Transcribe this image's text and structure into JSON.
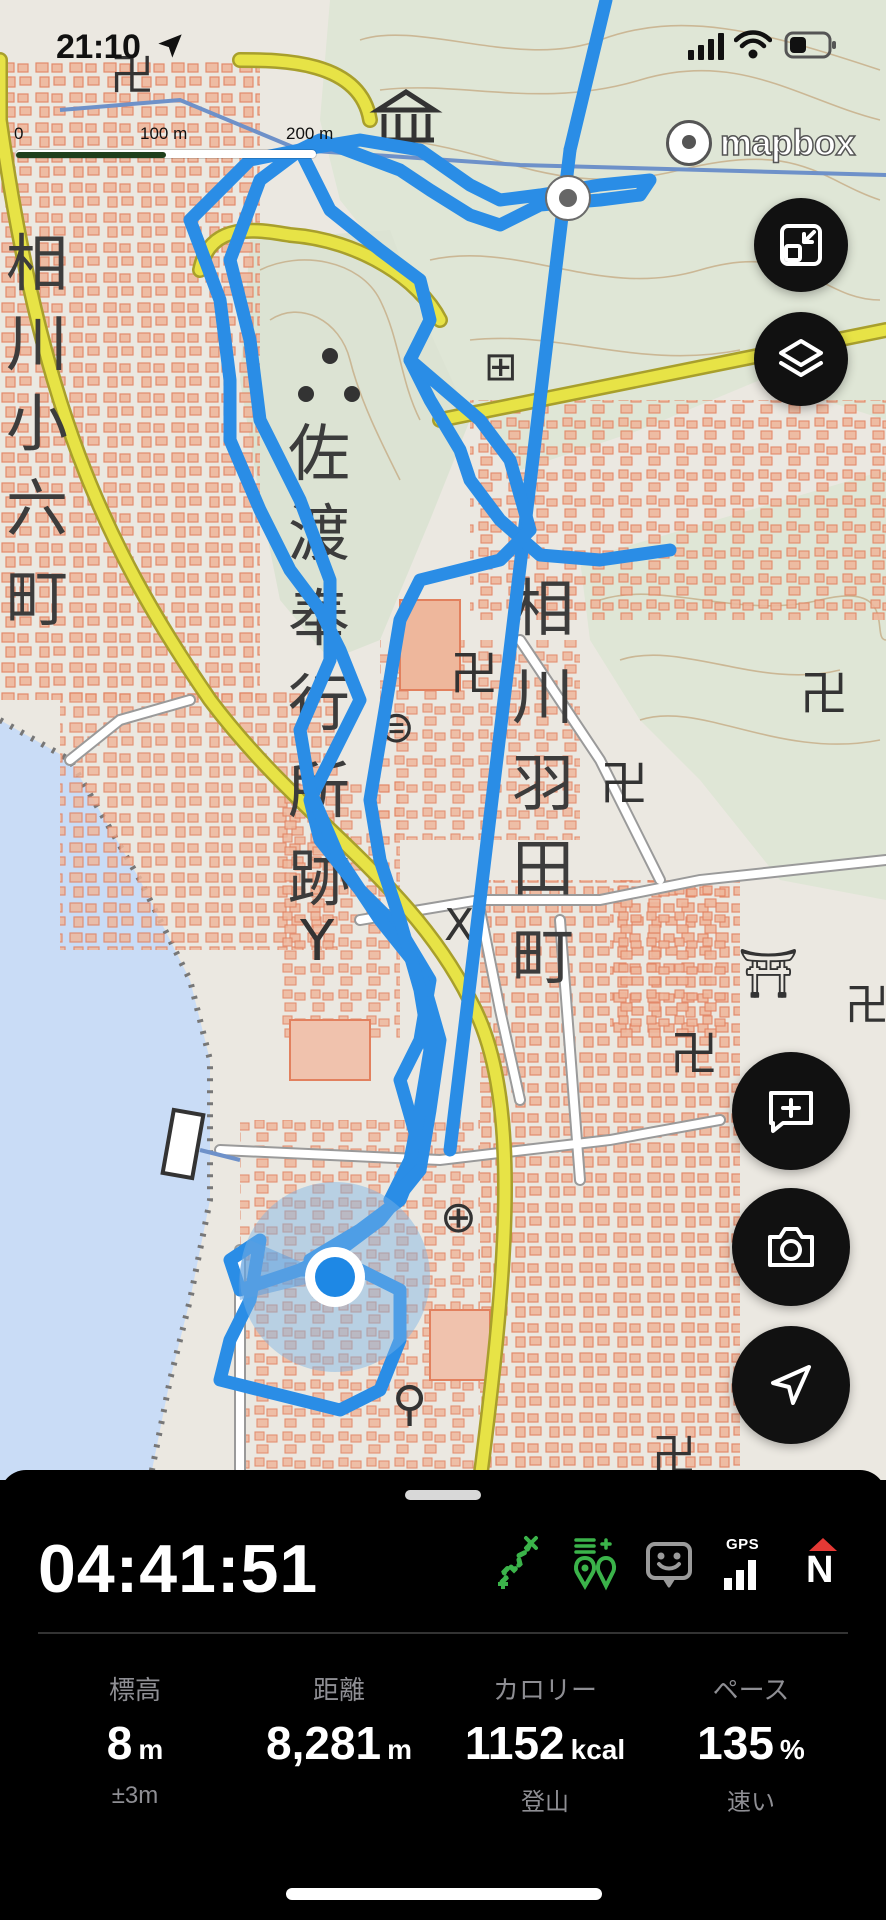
{
  "status_bar": {
    "time": "21:10",
    "icons": [
      "location-arrow-icon",
      "cellular-signal-icon",
      "wifi-icon",
      "battery-icon"
    ]
  },
  "map": {
    "scale_labels": [
      "0",
      "100 m",
      "200 m"
    ],
    "attribution": "mapbox",
    "place_labels": {
      "left_district": [
        "相",
        "川",
        "小",
        "六",
        "町"
      ],
      "site": [
        "佐",
        "渡",
        "奉",
        "行",
        "所",
        "跡"
      ],
      "right_district": [
        "相",
        "川",
        "羽",
        "田",
        "町"
      ]
    },
    "track_color": "#2a8de6",
    "road_color": "#e0dc3d",
    "water_color": "#c9dcf6",
    "building_color": "#e9a88c"
  },
  "controls": {
    "expand": "expand-map-icon",
    "layers": "layers-icon",
    "memo": "add-memo-icon",
    "camera": "camera-icon",
    "navigate": "navigation-arrow-icon"
  },
  "panel": {
    "elapsed_time": "04:41:51",
    "status_icons": {
      "route": "route-icon",
      "waypoints": "waypoint-pins-icon",
      "companion": "companion-device-icon",
      "gps": "GPS",
      "compass": "N"
    },
    "status_colors": {
      "green": "#3bb34a",
      "red": "#e53935",
      "grey": "#9a9a9a"
    },
    "stats": [
      {
        "label": "標高",
        "value": "8",
        "unit": "m",
        "sub": "±3m"
      },
      {
        "label": "距離",
        "value": "8,281",
        "unit": "m",
        "sub": ""
      },
      {
        "label": "カロリー",
        "value": "1152",
        "unit": "kcal",
        "sub": "登山"
      },
      {
        "label": "ペース",
        "value": "135",
        "unit": "%",
        "sub": "速い"
      }
    ]
  }
}
